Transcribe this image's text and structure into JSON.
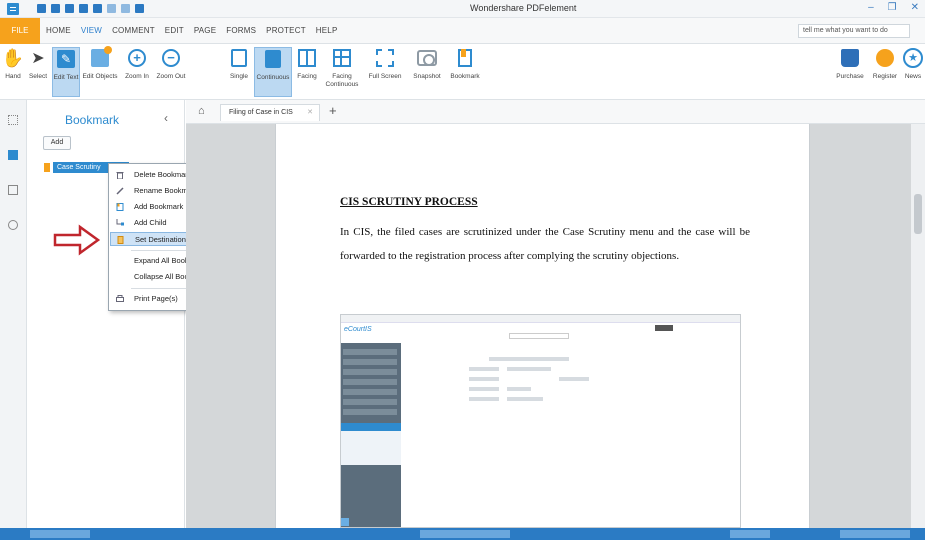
{
  "window": {
    "title": "Wondershare PDFelement",
    "controls": [
      "–",
      "❐",
      "✕"
    ]
  },
  "menu": {
    "file_tab": "FILE",
    "tabs": [
      {
        "label": "HOME",
        "active": false
      },
      {
        "label": "VIEW",
        "active": true
      },
      {
        "label": "COMMENT",
        "active": false
      },
      {
        "label": "EDIT",
        "active": false
      },
      {
        "label": "PAGE",
        "active": false
      },
      {
        "label": "FORMS",
        "active": false
      },
      {
        "label": "PROTECT",
        "active": false
      },
      {
        "label": "HELP",
        "active": false
      }
    ],
    "tell_me_placeholder": "tell me what you want to do"
  },
  "ribbon": {
    "tools": [
      {
        "label": "Hand",
        "icon": "hand-icon"
      },
      {
        "label": "Select",
        "icon": "select-arrow-icon"
      },
      {
        "label": "Edit Text",
        "icon": "edit-text-icon",
        "selected": true
      },
      {
        "label": "Edit Objects",
        "icon": "edit-objects-icon"
      },
      {
        "label": "Zoom In",
        "icon": "zoom-in-icon"
      },
      {
        "label": "Zoom Out",
        "icon": "zoom-out-icon"
      },
      {
        "label": "Single",
        "icon": "single-page-icon"
      },
      {
        "label": "Continuous",
        "icon": "continuous-page-icon",
        "selected": true
      },
      {
        "label": "Facing",
        "icon": "facing-page-icon"
      },
      {
        "label": "Facing Continuous",
        "icon": "facing-continuous-icon"
      },
      {
        "label": "Full Screen",
        "icon": "full-screen-icon"
      },
      {
        "label": "Snapshot",
        "icon": "snapshot-icon"
      },
      {
        "label": "Bookmark",
        "icon": "bookmark-icon"
      }
    ],
    "right_tools": [
      {
        "label": "Purchase",
        "icon": "cart-icon"
      },
      {
        "label": "Register",
        "icon": "register-icon"
      },
      {
        "label": "News",
        "icon": "news-icon"
      }
    ]
  },
  "bookmark_panel": {
    "title": "Bookmark",
    "add_label": "Add",
    "item_label": "Case Scrutiny"
  },
  "context_menu": {
    "items": [
      {
        "label": "Delete Bookmark(s)",
        "icon": "trash-icon"
      },
      {
        "label": "Rename Bookmark",
        "icon": "pencil-icon"
      },
      {
        "label": "Add Bookmark",
        "icon": "add-bookmark-icon"
      },
      {
        "label": "Add Child",
        "icon": "add-child-icon"
      },
      {
        "label": "Set Destination",
        "icon": "set-destination-icon",
        "highlighted": true
      },
      {
        "label": "Expand All Bookmarks",
        "icon": ""
      },
      {
        "label": "Collapse All Bookmarks",
        "icon": ""
      },
      {
        "label": "Print Page(s)",
        "icon": "print-icon"
      }
    ]
  },
  "document": {
    "tab_label": "Filing of Case in CIS",
    "heading": "CIS SCRUTINY PROCESS",
    "paragraph": "In CIS, the filed cases are scrutinized under the Case Scrutiny menu and the case will be forwarded to the registration process after complying the scrutiny objections.",
    "embedded_logo": "eCourtIS"
  },
  "colors": {
    "accent": "#2e8bcf",
    "file_tab": "#f6a21c",
    "arrow": "#c0262d",
    "status_bar": "#2b7bc4"
  }
}
